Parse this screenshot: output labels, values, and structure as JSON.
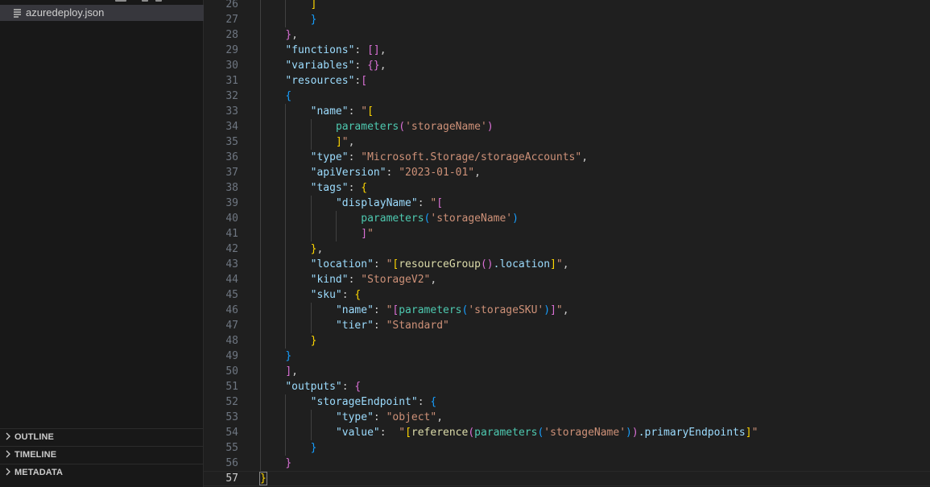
{
  "sidebar": {
    "file_name": "azuredeploy.json",
    "panels": [
      {
        "label": "OUTLINE"
      },
      {
        "label": "TIMELINE"
      },
      {
        "label": "METADATA"
      }
    ]
  },
  "editor": {
    "language": "json",
    "current_line": 57,
    "colors": {
      "background": "#1f1f1f",
      "key": "#9cdcfe",
      "string": "#ce9178",
      "bracket_gold": "#ffd700",
      "bracket_pink": "#da70d6",
      "bracket_blue": "#179fff",
      "function": "#dcdcaa",
      "parameter": "#4ec9b0"
    },
    "lines": [
      {
        "n": "26",
        "indent": 2,
        "segs": [
          [
            "]",
            "b1"
          ]
        ]
      },
      {
        "n": "27",
        "indent": 2,
        "segs": [
          [
            "}",
            "b3"
          ]
        ]
      },
      {
        "n": "28",
        "indent": 1,
        "segs": [
          [
            "}",
            "b2"
          ],
          [
            ",",
            "p"
          ]
        ]
      },
      {
        "n": "29",
        "indent": 1,
        "segs": [
          [
            "\"functions\"",
            "k"
          ],
          [
            ": ",
            "p"
          ],
          [
            "[]",
            "b2"
          ],
          [
            ",",
            "p"
          ]
        ]
      },
      {
        "n": "30",
        "indent": 1,
        "segs": [
          [
            "\"variables\"",
            "k"
          ],
          [
            ": ",
            "p"
          ],
          [
            "{}",
            "b2"
          ],
          [
            ",",
            "p"
          ]
        ]
      },
      {
        "n": "31",
        "indent": 1,
        "segs": [
          [
            "\"resources\"",
            "k"
          ],
          [
            ":",
            "p"
          ],
          [
            "[",
            "b2"
          ]
        ]
      },
      {
        "n": "32",
        "indent": 1,
        "segs": [
          [
            "{",
            "b3"
          ]
        ]
      },
      {
        "n": "33",
        "indent": 2,
        "segs": [
          [
            "\"name\"",
            "k"
          ],
          [
            ": ",
            "p"
          ],
          [
            "\"",
            "s"
          ],
          [
            "[",
            "b1"
          ]
        ]
      },
      {
        "n": "34",
        "indent": 3,
        "segs": [
          [
            "parameters",
            "q"
          ],
          [
            "(",
            "b2"
          ],
          [
            "'storageName'",
            "s"
          ],
          [
            ")",
            "b2"
          ]
        ]
      },
      {
        "n": "35",
        "indent": 3,
        "segs": [
          [
            "]",
            "b1"
          ],
          [
            "\"",
            "s"
          ],
          [
            ",",
            "p"
          ]
        ]
      },
      {
        "n": "36",
        "indent": 2,
        "segs": [
          [
            "\"type\"",
            "k"
          ],
          [
            ": ",
            "p"
          ],
          [
            "\"Microsoft.Storage/storageAccounts\"",
            "s"
          ],
          [
            ",",
            "p"
          ]
        ]
      },
      {
        "n": "37",
        "indent": 2,
        "segs": [
          [
            "\"apiVersion\"",
            "k"
          ],
          [
            ": ",
            "p"
          ],
          [
            "\"2023-01-01\"",
            "s"
          ],
          [
            ",",
            "p"
          ]
        ]
      },
      {
        "n": "38",
        "indent": 2,
        "segs": [
          [
            "\"tags\"",
            "k"
          ],
          [
            ": ",
            "p"
          ],
          [
            "{",
            "b1"
          ]
        ]
      },
      {
        "n": "39",
        "indent": 3,
        "segs": [
          [
            "\"displayName\"",
            "k"
          ],
          [
            ": ",
            "p"
          ],
          [
            "\"",
            "s"
          ],
          [
            "[",
            "b2"
          ]
        ]
      },
      {
        "n": "40",
        "indent": 4,
        "segs": [
          [
            "parameters",
            "q"
          ],
          [
            "(",
            "b3"
          ],
          [
            "'storageName'",
            "s"
          ],
          [
            ")",
            "b3"
          ]
        ]
      },
      {
        "n": "41",
        "indent": 4,
        "segs": [
          [
            "]",
            "b2"
          ],
          [
            "\"",
            "s"
          ]
        ]
      },
      {
        "n": "42",
        "indent": 2,
        "segs": [
          [
            "}",
            "b1"
          ],
          [
            ",",
            "p"
          ]
        ]
      },
      {
        "n": "43",
        "indent": 2,
        "segs": [
          [
            "\"location\"",
            "k"
          ],
          [
            ": ",
            "p"
          ],
          [
            "\"",
            "s"
          ],
          [
            "[",
            "b1"
          ],
          [
            "resourceGroup",
            "f"
          ],
          [
            "()",
            "b2"
          ],
          [
            ".location",
            "k"
          ],
          [
            "]",
            "b1"
          ],
          [
            "\"",
            "s"
          ],
          [
            ",",
            "p"
          ]
        ]
      },
      {
        "n": "44",
        "indent": 2,
        "segs": [
          [
            "\"kind\"",
            "k"
          ],
          [
            ": ",
            "p"
          ],
          [
            "\"StorageV2\"",
            "s"
          ],
          [
            ",",
            "p"
          ]
        ]
      },
      {
        "n": "45",
        "indent": 2,
        "segs": [
          [
            "\"sku\"",
            "k"
          ],
          [
            ": ",
            "p"
          ],
          [
            "{",
            "b1"
          ]
        ]
      },
      {
        "n": "46",
        "indent": 3,
        "segs": [
          [
            "\"name\"",
            "k"
          ],
          [
            ": ",
            "p"
          ],
          [
            "\"",
            "s"
          ],
          [
            "[",
            "b2"
          ],
          [
            "parameters",
            "q"
          ],
          [
            "(",
            "b3"
          ],
          [
            "'storageSKU'",
            "s"
          ],
          [
            ")",
            "b3"
          ],
          [
            "]",
            "b2"
          ],
          [
            "\"",
            "s"
          ],
          [
            ",",
            "p"
          ]
        ]
      },
      {
        "n": "47",
        "indent": 3,
        "segs": [
          [
            "\"tier\"",
            "k"
          ],
          [
            ": ",
            "p"
          ],
          [
            "\"Standard\"",
            "s"
          ]
        ]
      },
      {
        "n": "48",
        "indent": 2,
        "segs": [
          [
            "}",
            "b1"
          ]
        ]
      },
      {
        "n": "49",
        "indent": 1,
        "segs": [
          [
            "}",
            "b3"
          ]
        ]
      },
      {
        "n": "50",
        "indent": 1,
        "segs": [
          [
            "]",
            "b2"
          ],
          [
            ",",
            "p"
          ]
        ]
      },
      {
        "n": "51",
        "indent": 1,
        "segs": [
          [
            "\"outputs\"",
            "k"
          ],
          [
            ": ",
            "p"
          ],
          [
            "{",
            "b2"
          ]
        ]
      },
      {
        "n": "52",
        "indent": 2,
        "segs": [
          [
            "\"storageEndpoint\"",
            "k"
          ],
          [
            ": ",
            "p"
          ],
          [
            "{",
            "b3"
          ]
        ]
      },
      {
        "n": "53",
        "indent": 3,
        "segs": [
          [
            "\"type\"",
            "k"
          ],
          [
            ": ",
            "p"
          ],
          [
            "\"object\"",
            "s"
          ],
          [
            ",",
            "p"
          ]
        ]
      },
      {
        "n": "54",
        "indent": 3,
        "segs": [
          [
            "\"value\"",
            "k"
          ],
          [
            ":  ",
            "p"
          ],
          [
            "\"",
            "s"
          ],
          [
            "[",
            "b1"
          ],
          [
            "reference",
            "f"
          ],
          [
            "(",
            "b2"
          ],
          [
            "parameters",
            "q"
          ],
          [
            "(",
            "b3"
          ],
          [
            "'storageName'",
            "s"
          ],
          [
            "))",
            "b3b2"
          ],
          [
            ".primaryEndpoints",
            "k"
          ],
          [
            "]",
            "b1"
          ],
          [
            "\"",
            "s"
          ]
        ]
      },
      {
        "n": "55",
        "indent": 2,
        "segs": [
          [
            "}",
            "b3"
          ]
        ]
      },
      {
        "n": "56",
        "indent": 1,
        "segs": [
          [
            "}",
            "b2"
          ]
        ]
      },
      {
        "n": "57",
        "indent": 0,
        "segs": [
          [
            "}",
            "b1box"
          ]
        ]
      }
    ]
  }
}
